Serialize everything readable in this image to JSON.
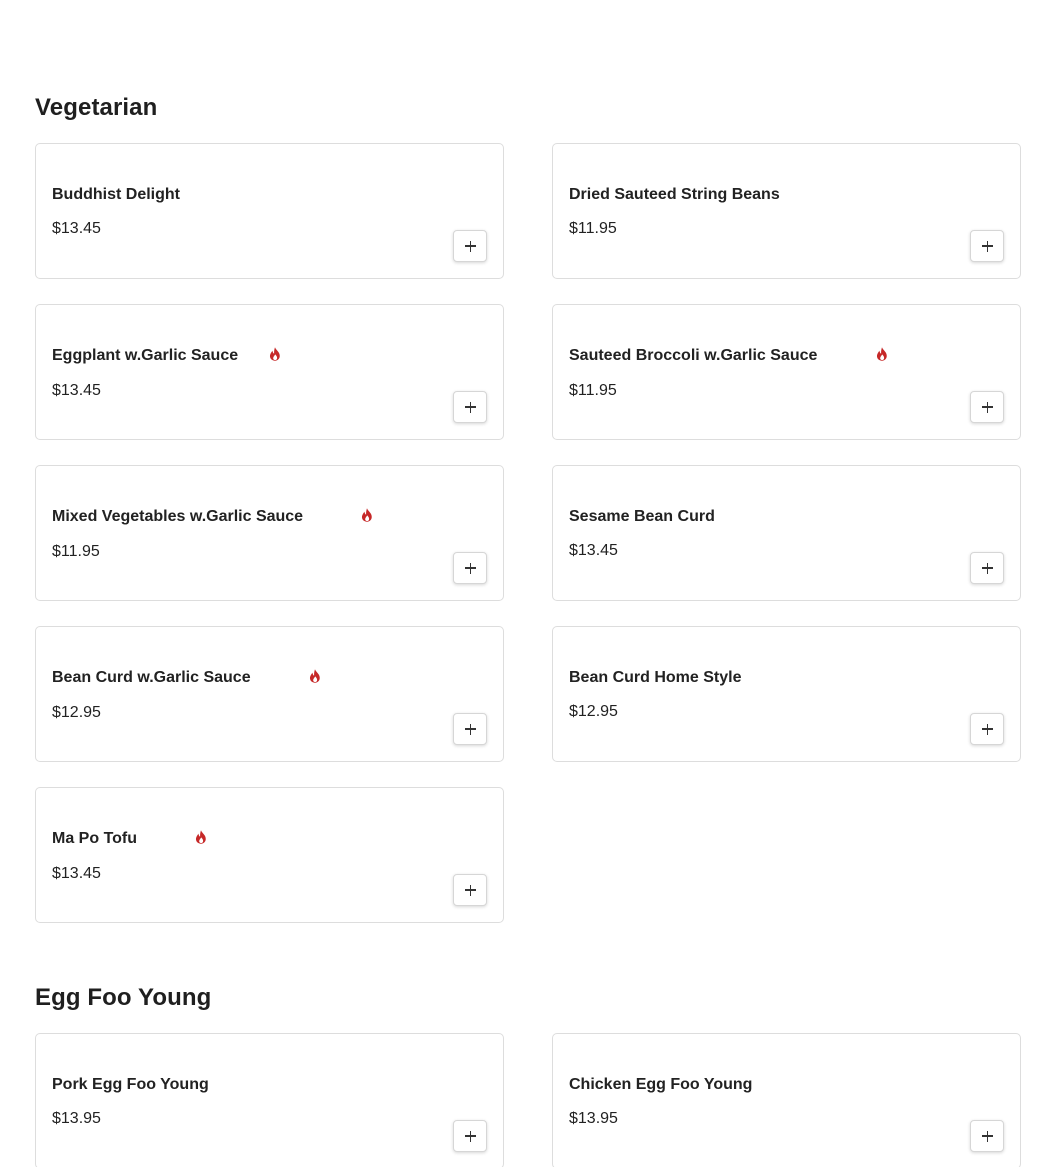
{
  "sections": [
    {
      "title": "Vegetarian",
      "items": [
        {
          "name": "Buddhist Delight",
          "price": "$13.45",
          "spicy": false
        },
        {
          "name": "Dried Sauteed String Beans",
          "price": "$11.95",
          "spicy": false
        },
        {
          "name": "Eggplant w.Garlic Sauce",
          "price": "$13.45",
          "spicy": true
        },
        {
          "name": "Sauteed Broccoli w.Garlic Sauce",
          "price": "$11.95",
          "spicy": true
        },
        {
          "name": "Mixed Vegetables w.Garlic Sauce",
          "price": "$11.95",
          "spicy": true
        },
        {
          "name": "Sesame Bean Curd",
          "price": "$13.45",
          "spicy": false
        },
        {
          "name": "Bean Curd w.Garlic Sauce",
          "price": "$12.95",
          "spicy": true
        },
        {
          "name": "Bean Curd Home Style",
          "price": "$12.95",
          "spicy": false
        },
        {
          "name": "Ma Po Tofu",
          "price": "$13.45",
          "spicy": true
        }
      ]
    },
    {
      "title": "Egg Foo Young",
      "items": [
        {
          "name": "Pork Egg Foo Young",
          "price": "$13.95",
          "spicy": false
        },
        {
          "name": "Chicken Egg Foo Young",
          "price": "$13.95",
          "spicy": false
        }
      ]
    }
  ],
  "icons": {
    "spicy": "flame-icon",
    "add": "plus-icon"
  },
  "colors": {
    "spicy": "#c62828",
    "card_border": "#dddddd",
    "text": "#1f1f1f"
  }
}
